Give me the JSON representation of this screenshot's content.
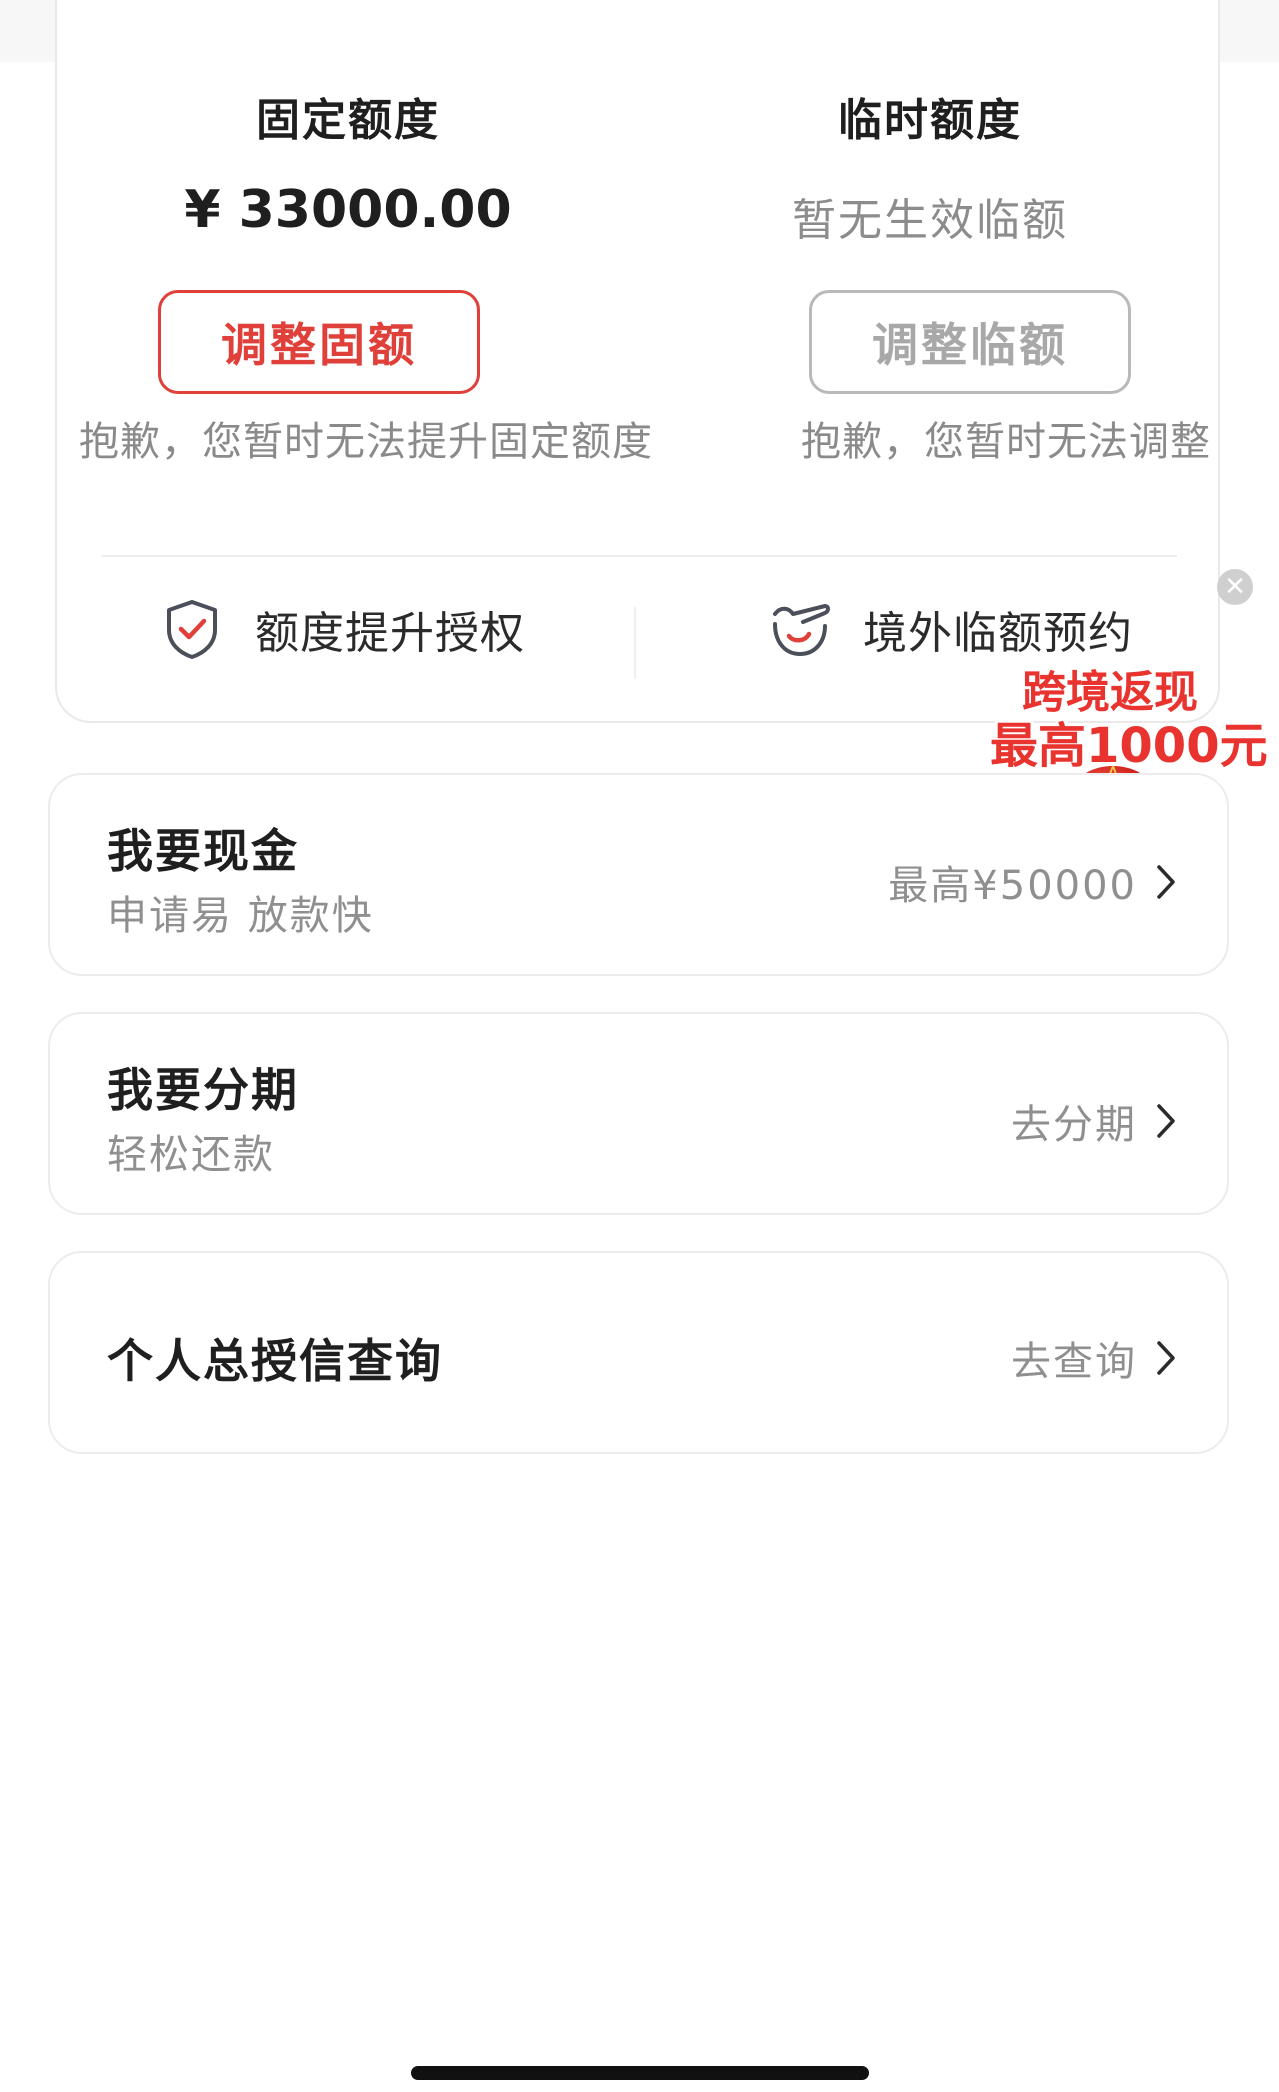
{
  "credit": {
    "fixed": {
      "title": "固定额度",
      "amount": "¥ 33000.00",
      "button": "调整固额",
      "note": "抱歉，您暂时无法提升固定额度"
    },
    "temporary": {
      "title": "临时额度",
      "amount_text": "暂无生效临额",
      "button": "调整临额",
      "note": "抱歉，您暂时无法调整"
    },
    "actions": [
      {
        "label": "额度提升授权",
        "icon": "shield-check-icon"
      },
      {
        "label": "境外临额预约",
        "icon": "plane-smile-icon"
      }
    ]
  },
  "promo": {
    "line1": "跨境返现",
    "line2": "最高1000元",
    "icon": "hot-air-balloon-icon",
    "close_icon": "close-icon"
  },
  "list": [
    {
      "title": "我要现金",
      "subtitle": "申请易 放款快",
      "right_text": "最高¥50000"
    },
    {
      "title": "我要分期",
      "subtitle": "轻松还款",
      "right_text": "去分期"
    },
    {
      "title": "个人总授信查询",
      "subtitle": "",
      "right_text": "去查询"
    }
  ],
  "colors": {
    "accent_red": "#e0403a",
    "disabled_gray": "#b9b9b9",
    "text_muted": "#8f8f8f"
  }
}
